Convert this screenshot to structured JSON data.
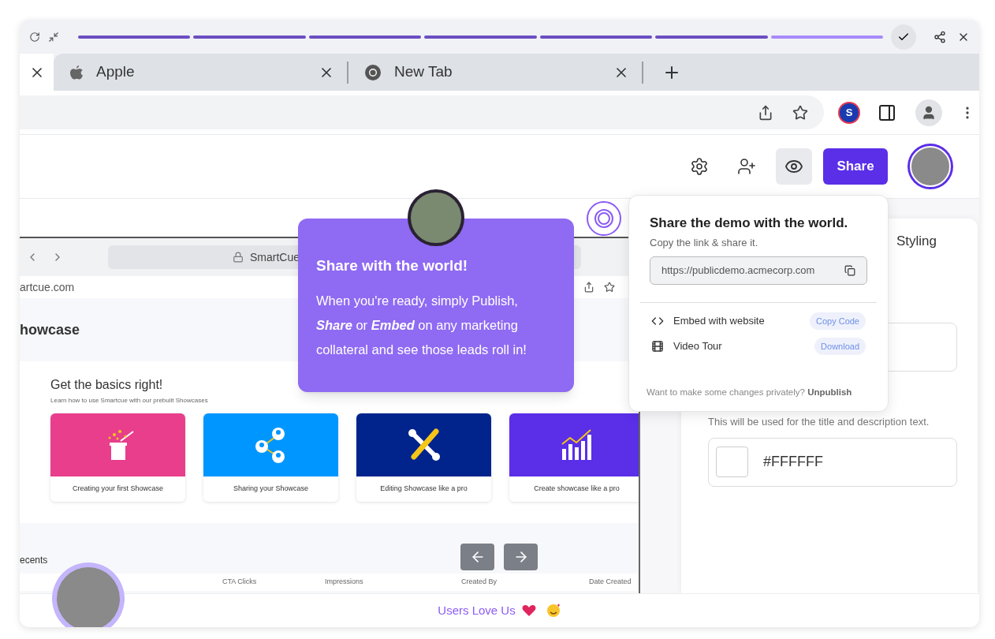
{
  "player": {
    "steps": [
      {
        "completed": true
      },
      {
        "completed": true
      },
      {
        "completed": true
      },
      {
        "completed": true
      },
      {
        "completed": true
      },
      {
        "completed": true
      },
      {
        "completed": false
      }
    ]
  },
  "browser": {
    "tabs": [
      {
        "title": "Apple",
        "kind": "apple"
      },
      {
        "title": "New Tab",
        "kind": "chrome"
      }
    ],
    "extension_badge": "S"
  },
  "header": {
    "actions": [
      {
        "kind": "settings",
        "selected": false
      },
      {
        "kind": "add-user",
        "selected": false
      },
      {
        "kind": "preview",
        "selected": true
      }
    ],
    "share_button": "Share"
  },
  "preview": {
    "address": "SmartCue",
    "url": "artcue.com",
    "heading": "howcase",
    "section_title": "Get the basics right!",
    "section_subtitle": "Learn how to use Smartcue with our prebuilt Showcases",
    "cards": [
      {
        "caption": "Creating your first Showcase",
        "color": "#e83e8c",
        "kind": "magic"
      },
      {
        "caption": "Sharing your Showcase",
        "color": "#0096ff",
        "kind": "network"
      },
      {
        "caption": "Editing Showcase like a pro",
        "color": "#00248c",
        "kind": "tools"
      },
      {
        "caption": "Create showcase like a pro",
        "color": "#5b2ee8",
        "kind": "chart"
      }
    ],
    "recents_title": "ecents",
    "columns": [
      "CTA Clicks",
      "Impressions",
      "Created By",
      "Date Created"
    ]
  },
  "tour_tooltip": {
    "title": "Share with the world!",
    "body": "When you're ready, simply Publish, **Share** or **Embed** on any marketing collateral and see those leads roll in!"
  },
  "share_popover": {
    "title": "Share the demo with the world.",
    "subtitle": "Copy the link & share it.",
    "link": "https://publicdemo.acmecorp.com",
    "options": [
      {
        "kind": "embed",
        "label": "Embed with website",
        "action": "Copy Code"
      },
      {
        "kind": "video",
        "label": "Video Tour",
        "action": "Download"
      }
    ],
    "footer": "Want to make some changes privately? **Unpublish**"
  },
  "styling_panel": {
    "tab": "Styling",
    "helper_text": "This will be used for the title and description text.",
    "color_value": "#FFFFFF"
  },
  "footer": {
    "text": "Users Love Us"
  }
}
